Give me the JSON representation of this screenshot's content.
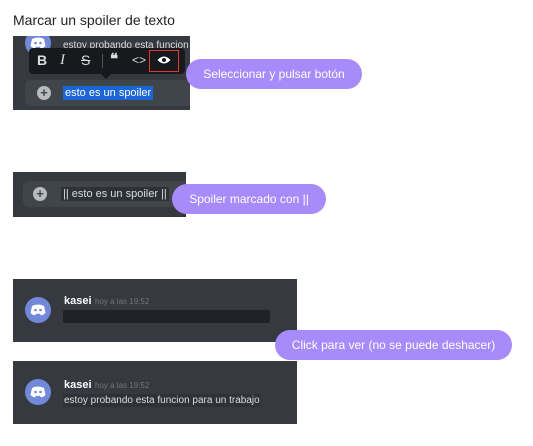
{
  "page": {
    "title": "Marcar un spoiler de texto"
  },
  "step1": {
    "partial_message": "estoy probando esta funcion",
    "toolbar": {
      "bold": "B",
      "italic": "I",
      "strike": "S",
      "quote": "❝",
      "code": "<>",
      "spoiler_icon": "eye-icon"
    },
    "input_text": "esto es un spoiler",
    "callout": "Seleccionar y pulsar botón"
  },
  "step2": {
    "input_text": "|| esto es un spoiler ||",
    "callout": "Spoiler marcado con ||"
  },
  "step3": {
    "username": "kasei",
    "timestamp": "hoy a las 19:52",
    "callout": "Click para ver (no se puede deshacer)"
  },
  "step4": {
    "username": "kasei",
    "timestamp": "hoy a las 19:52",
    "message": "estoy probando esta funcion para un trabajo"
  },
  "colors": {
    "accent": "#a78bfa",
    "discord_bg": "#36393f",
    "input_bg": "#40444b",
    "selection": "#1a66d6",
    "highlight_box": "#e53935"
  }
}
